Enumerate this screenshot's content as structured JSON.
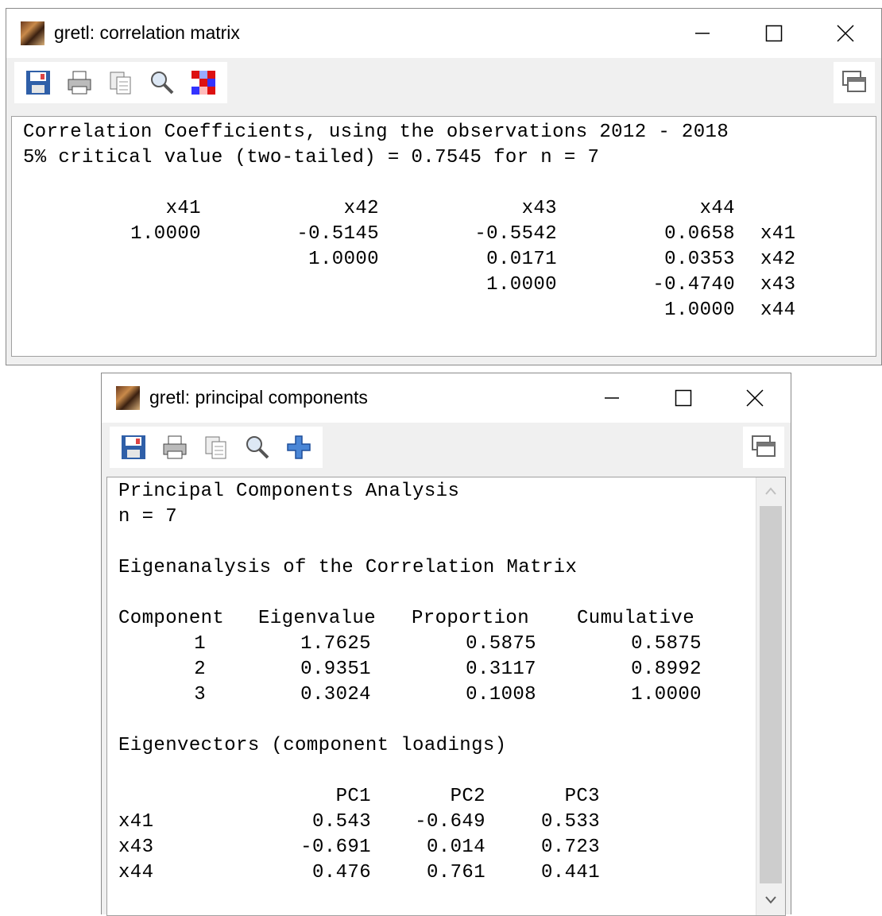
{
  "corr_window": {
    "title": "gretl: correlation matrix",
    "toolbar_icons": [
      "save-icon",
      "print-icon",
      "copy-icon",
      "find-icon",
      "heatmap-icon"
    ],
    "lines": [
      "Correlation Coefficients, using the observations 2012 - 2018",
      "5% critical value (two-tailed) = 0.7545 for n = 7"
    ],
    "matrix": {
      "headers": [
        "x41",
        "x42",
        "x43",
        "x44"
      ],
      "rows": [
        {
          "cells": [
            "1.0000",
            "-0.5145",
            "-0.5542",
            "0.0658"
          ],
          "label": "x41"
        },
        {
          "cells": [
            "",
            "1.0000",
            "0.0171",
            "0.0353"
          ],
          "label": "x42"
        },
        {
          "cells": [
            "",
            "",
            "1.0000",
            "-0.4740"
          ],
          "label": "x43"
        },
        {
          "cells": [
            "",
            "",
            "",
            "1.0000"
          ],
          "label": "x44"
        }
      ]
    }
  },
  "pca_window": {
    "title": "gretl: principal components",
    "toolbar_icons": [
      "save-icon",
      "print-icon",
      "copy-icon",
      "find-icon",
      "add-icon"
    ],
    "heading": "Principal Components Analysis",
    "n_line": "n = 7",
    "eigen_heading": "Eigenanalysis of the Correlation Matrix",
    "eigen_table": {
      "headers": [
        "Component",
        "Eigenvalue",
        "Proportion",
        "Cumulative"
      ],
      "rows": [
        [
          "1",
          "1.7625",
          "0.5875",
          "0.5875"
        ],
        [
          "2",
          "0.9351",
          "0.3117",
          "0.8992"
        ],
        [
          "3",
          "0.3024",
          "0.1008",
          "1.0000"
        ]
      ]
    },
    "vectors_heading": "Eigenvectors (component loadings)",
    "vectors_table": {
      "headers": [
        "PC1",
        "PC2",
        "PC3"
      ],
      "rows": [
        {
          "label": "x41",
          "values": [
            "0.543",
            "-0.649",
            "0.533"
          ]
        },
        {
          "label": "x43",
          "values": [
            "-0.691",
            "0.014",
            "0.723"
          ]
        },
        {
          "label": "x44",
          "values": [
            "0.476",
            "0.761",
            "0.441"
          ]
        }
      ]
    }
  }
}
